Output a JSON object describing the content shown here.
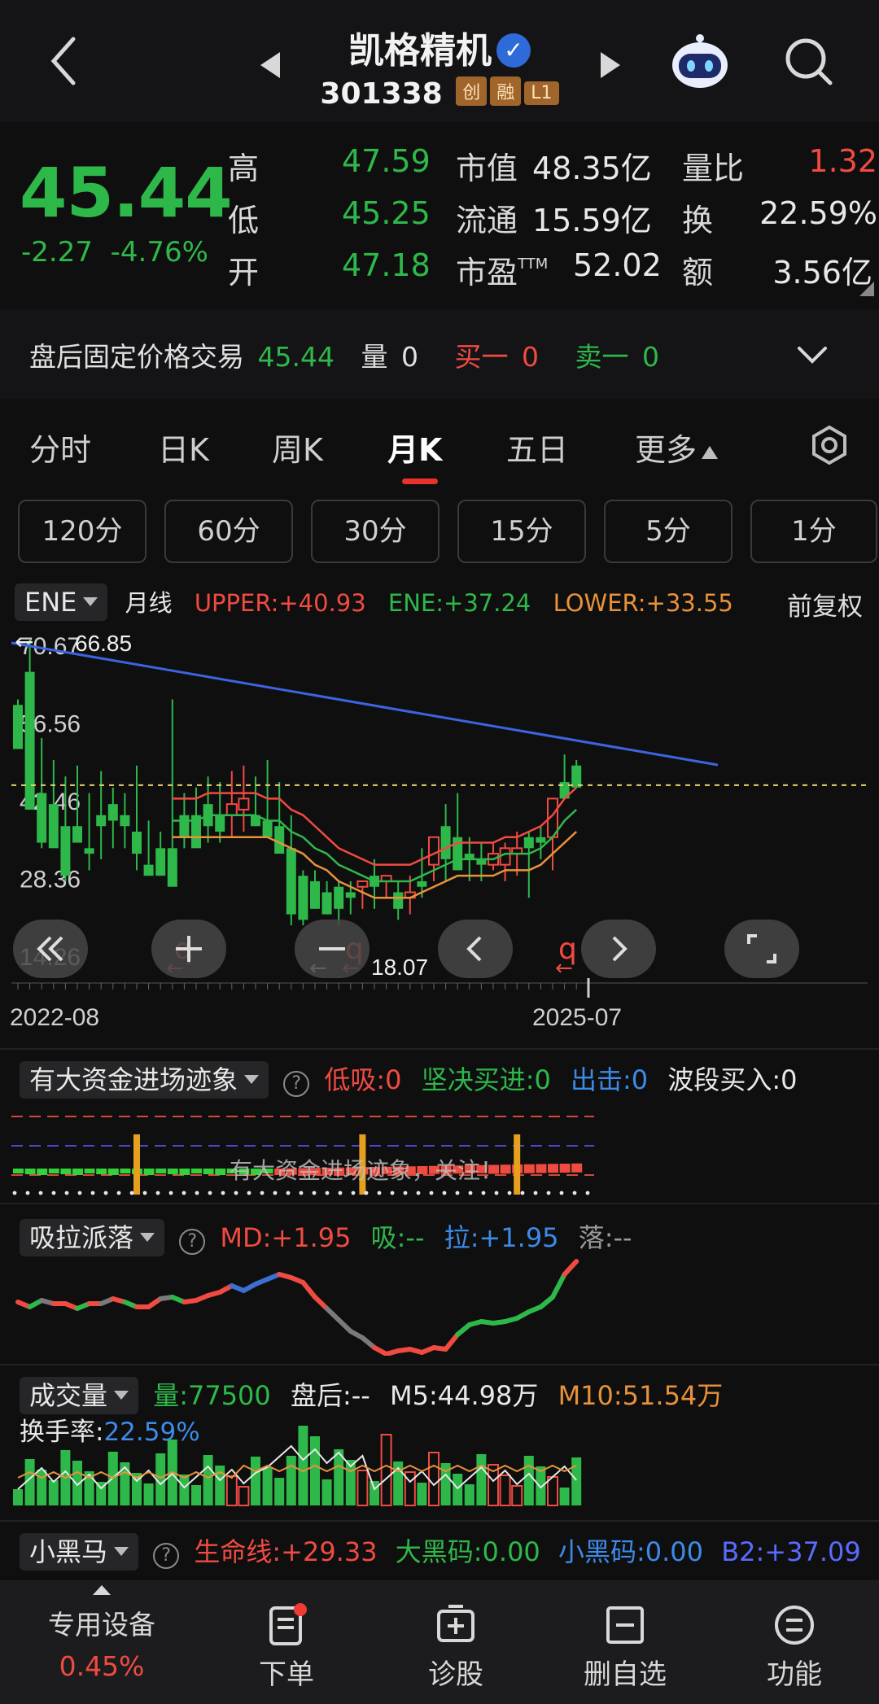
{
  "header": {
    "stock_name": "凯格精机",
    "stock_code": "301338",
    "tags": [
      "创",
      "融",
      "L1"
    ]
  },
  "quote": {
    "price": "45.44",
    "change": "-2.27",
    "change_pct": "-4.76%",
    "high_label": "高",
    "high": "47.59",
    "low_label": "低",
    "low": "45.25",
    "open_label": "开",
    "open": "47.18",
    "mktcap_label": "市值",
    "mktcap": "48.35亿",
    "float_label": "流通",
    "float": "15.59亿",
    "pe_label": "市盈",
    "pe_sup": "TTM",
    "pe": "52.02",
    "volratio_label": "量比",
    "volratio": "1.32",
    "turnover_label": "换",
    "turnover": "22.59%",
    "amount_label": "额",
    "amount": "3.56亿"
  },
  "afterhours": {
    "label": "盘后固定价格交易",
    "price": "45.44",
    "vol_label": "量",
    "vol": "0",
    "buy1_label": "买一",
    "buy1": "0",
    "sell1_label": "卖一",
    "sell1": "0"
  },
  "tabs": [
    "分时",
    "日K",
    "周K",
    "月K",
    "五日",
    "更多"
  ],
  "active_tab": "月K",
  "periods": [
    "120分",
    "60分",
    "30分",
    "15分",
    "5分",
    "1分"
  ],
  "main_indicator": {
    "name": "ENE",
    "period": "月线",
    "upper": "UPPER:+40.93",
    "ene": "ENE:+37.24",
    "lower": "LOWER:+33.55",
    "adjust": "前复权"
  },
  "chart_data": {
    "type": "candlestick",
    "y_ticks": [
      "70.67",
      "56.56",
      "42.46",
      "28.36",
      "14.26"
    ],
    "ylim": [
      14.26,
      70.67
    ],
    "x_start": "2022-08",
    "x_end": "2025-07",
    "max_marker": "66.85",
    "min_marker": "18.07",
    "last_price": 45.44,
    "candles": [
      [
        60,
        61,
        54,
        52
      ],
      [
        66,
        72,
        52,
        41
      ],
      [
        44,
        54,
        34,
        35
      ],
      [
        42,
        50,
        38,
        34
      ],
      [
        38,
        47,
        28,
        29
      ],
      [
        38,
        49,
        36,
        35
      ],
      [
        34,
        44,
        30,
        33
      ],
      [
        40,
        48,
        32,
        38
      ],
      [
        42,
        45,
        34,
        39
      ],
      [
        40,
        44,
        34,
        38
      ],
      [
        37,
        49,
        30,
        33
      ],
      [
        31,
        39,
        31,
        29
      ],
      [
        34,
        37,
        31,
        29
      ],
      [
        34,
        61,
        34,
        27
      ],
      [
        40,
        44,
        34,
        36
      ],
      [
        40,
        45,
        36,
        34
      ],
      [
        42,
        47,
        35,
        38
      ],
      [
        40,
        46,
        35,
        37
      ],
      [
        40,
        48,
        36,
        42
      ],
      [
        41,
        49,
        37,
        43
      ],
      [
        40,
        47,
        38,
        38
      ],
      [
        39,
        50,
        38,
        36
      ],
      [
        38,
        46,
        34,
        33
      ],
      [
        34,
        40,
        20,
        22
      ],
      [
        29,
        30,
        20,
        21
      ],
      [
        28,
        30,
        24,
        23
      ],
      [
        26,
        28,
        22,
        22
      ],
      [
        27,
        28,
        20,
        23
      ],
      [
        26,
        28,
        22,
        25
      ],
      [
        27,
        28,
        23,
        28
      ],
      [
        29,
        32,
        23,
        27
      ],
      [
        28,
        29,
        25,
        29
      ],
      [
        26,
        28,
        21,
        23
      ],
      [
        25,
        29,
        22,
        26
      ],
      [
        28,
        34,
        25,
        27
      ],
      [
        31,
        35,
        28,
        36
      ],
      [
        38,
        42,
        28,
        32
      ],
      [
        36,
        44,
        30,
        30
      ],
      [
        33,
        36,
        28,
        32
      ],
      [
        32,
        35,
        28,
        31
      ],
      [
        31,
        35,
        30,
        33
      ],
      [
        31,
        35,
        28,
        34
      ],
      [
        33,
        37,
        29,
        34
      ],
      [
        36,
        37,
        25,
        34
      ],
      [
        36,
        38,
        32,
        35
      ],
      [
        36,
        40,
        30,
        43
      ],
      [
        46,
        51,
        43,
        43
      ],
      [
        49,
        50,
        45,
        45
      ]
    ],
    "upper": [
      null,
      null,
      null,
      null,
      null,
      null,
      null,
      null,
      null,
      null,
      null,
      null,
      null,
      43,
      43,
      43,
      44,
      44,
      44,
      44,
      44,
      43,
      43,
      41,
      40,
      38,
      36,
      34,
      33,
      32,
      31,
      31,
      31,
      31,
      32,
      33,
      34,
      35,
      35,
      35,
      35,
      36,
      36,
      37,
      38,
      40,
      43,
      45
    ],
    "middle": [
      null,
      null,
      null,
      null,
      null,
      null,
      null,
      null,
      null,
      null,
      null,
      null,
      null,
      39,
      39,
      39,
      40,
      40,
      40,
      40,
      40,
      39,
      39,
      37,
      36,
      34,
      33,
      31,
      30,
      29,
      28,
      28,
      28,
      28,
      29,
      30,
      31,
      32,
      32,
      32,
      32,
      33,
      33,
      33,
      34,
      36,
      39,
      41
    ],
    "lower": [
      null,
      null,
      null,
      null,
      null,
      null,
      null,
      null,
      null,
      null,
      null,
      null,
      null,
      36,
      36,
      36,
      36,
      36,
      36,
      36,
      36,
      36,
      35,
      34,
      33,
      31,
      30,
      28,
      27,
      26,
      25,
      25,
      25,
      25,
      26,
      27,
      28,
      29,
      29,
      29,
      29,
      30,
      30,
      30,
      31,
      33,
      35,
      37
    ]
  },
  "big_fund_indicator": {
    "name": "有大资金进场迹象",
    "low_buy": "低吸:0",
    "firm_buy": "坚决买进:0",
    "strike": "出击:0",
    "wave_buy": "波段买入:0",
    "notice": "有大资金进场迹象，关注！"
  },
  "xila_indicator": {
    "name": "吸拉派落",
    "md": "MD:+1.95",
    "xi": "吸:--",
    "la": "拉:+1.95",
    "luo": "落:--"
  },
  "volume_indicator": {
    "name": "成交量",
    "vol": "量:77500",
    "after": "盘后:--",
    "m5": "M5:44.98万",
    "m10": "M10:51.54万",
    "turnover_label": "换手率:",
    "turnover": "22.59%"
  },
  "heima_indicator": {
    "name": "小黑马",
    "life": "生命线:+29.33",
    "big": "大黑码:0.00",
    "small": "小黑码:0.00",
    "b2": "B2:+37.09"
  },
  "bottom_nav": {
    "device_label": "专用设备",
    "device_pct": "0.45%",
    "order": "下单",
    "diagnose": "诊股",
    "remove_watch": "删自选",
    "function": "功能"
  },
  "colors": {
    "up": "#f04b41",
    "down": "#2fb84a",
    "trend": "#3d64e0"
  }
}
